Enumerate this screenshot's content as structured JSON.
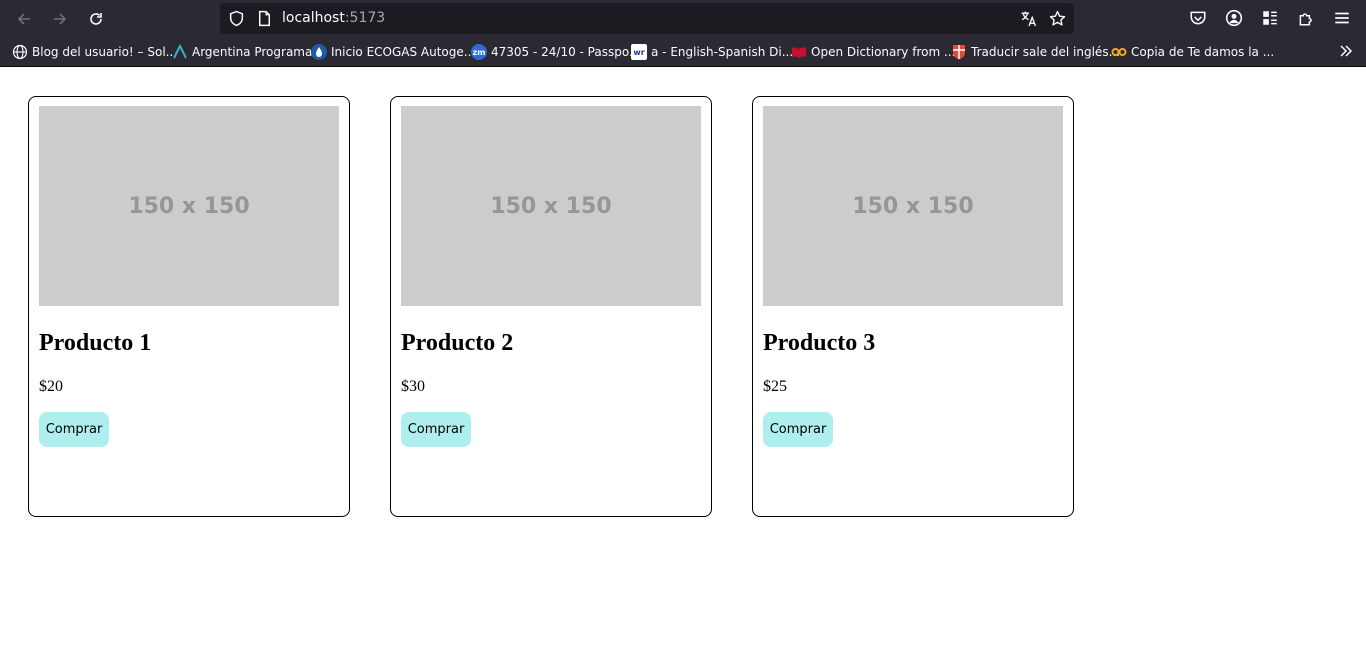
{
  "browser": {
    "url_host": "localhost",
    "url_port": ":5173",
    "bookmarks": [
      {
        "label": "Blog del usuario! – Sol...",
        "icon": "globe-icon"
      },
      {
        "label": "Argentina Programa",
        "icon": "argentina-programa-icon"
      },
      {
        "label": "Inicio ECOGAS Autoge...",
        "icon": "ecogas-icon"
      },
      {
        "label": "47305 - 24/10 - Passpo...",
        "icon": "zm-icon"
      },
      {
        "label": "a - English-Spanish Di...",
        "icon": "wordreference-icon"
      },
      {
        "label": "Open Dictionary from ...",
        "icon": "dictionary-icon"
      },
      {
        "label": "Traducir sale del inglés...",
        "icon": "cambridge-icon"
      },
      {
        "label": "Copia de Te damos la ...",
        "icon": "infinity-icon"
      }
    ]
  },
  "products": [
    {
      "name": "Producto 1",
      "price": "$20",
      "image_text": "150 x 150",
      "button": "Comprar"
    },
    {
      "name": "Producto 2",
      "price": "$30",
      "image_text": "150 x 150",
      "button": "Comprar"
    },
    {
      "name": "Producto 3",
      "price": "$25",
      "image_text": "150 x 150",
      "button": "Comprar"
    }
  ],
  "colors": {
    "chrome_bg": "#2b2a33",
    "urlbar_bg": "#1c1b22",
    "placeholder_bg": "#cccccc",
    "button_bg": "#afeeee"
  }
}
